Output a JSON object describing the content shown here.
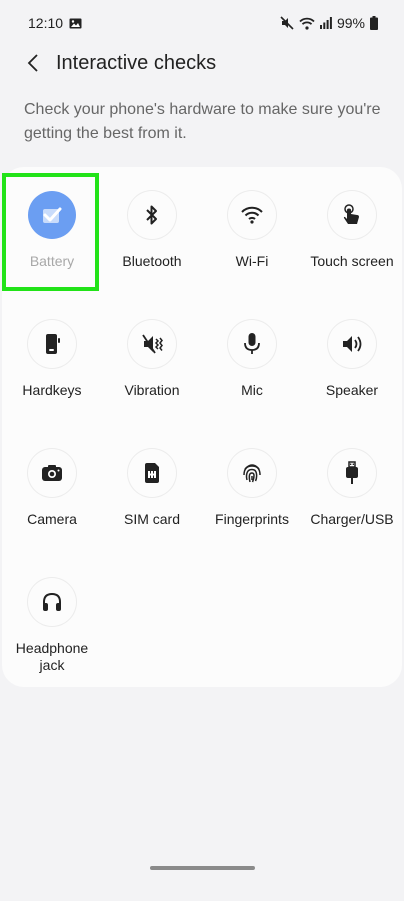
{
  "status_bar": {
    "time": "12:10",
    "battery": "99%"
  },
  "header": {
    "title": "Interactive checks"
  },
  "description": "Check your phone's hardware to make sure you're getting the best from it.",
  "colors": {
    "accent": "#6b9ef2",
    "highlight": "#22e318",
    "text": "#222222",
    "muted": "#a8a8a8"
  },
  "checks": [
    {
      "label": "Battery",
      "icon": "battery-check-icon",
      "selected": true
    },
    {
      "label": "Bluetooth",
      "icon": "bluetooth-icon"
    },
    {
      "label": "Wi-Fi",
      "icon": "wifi-icon"
    },
    {
      "label": "Touch screen",
      "icon": "touch-icon"
    },
    {
      "label": "Hardkeys",
      "icon": "hardkeys-icon"
    },
    {
      "label": "Vibration",
      "icon": "vibration-icon"
    },
    {
      "label": "Mic",
      "icon": "mic-icon"
    },
    {
      "label": "Speaker",
      "icon": "speaker-icon"
    },
    {
      "label": "Camera",
      "icon": "camera-icon"
    },
    {
      "label": "SIM card",
      "icon": "sim-card-icon"
    },
    {
      "label": "Fingerprints",
      "icon": "fingerprint-icon"
    },
    {
      "label": "Charger/USB",
      "icon": "usb-icon"
    },
    {
      "label": "Headphone jack",
      "icon": "headphone-icon"
    }
  ]
}
